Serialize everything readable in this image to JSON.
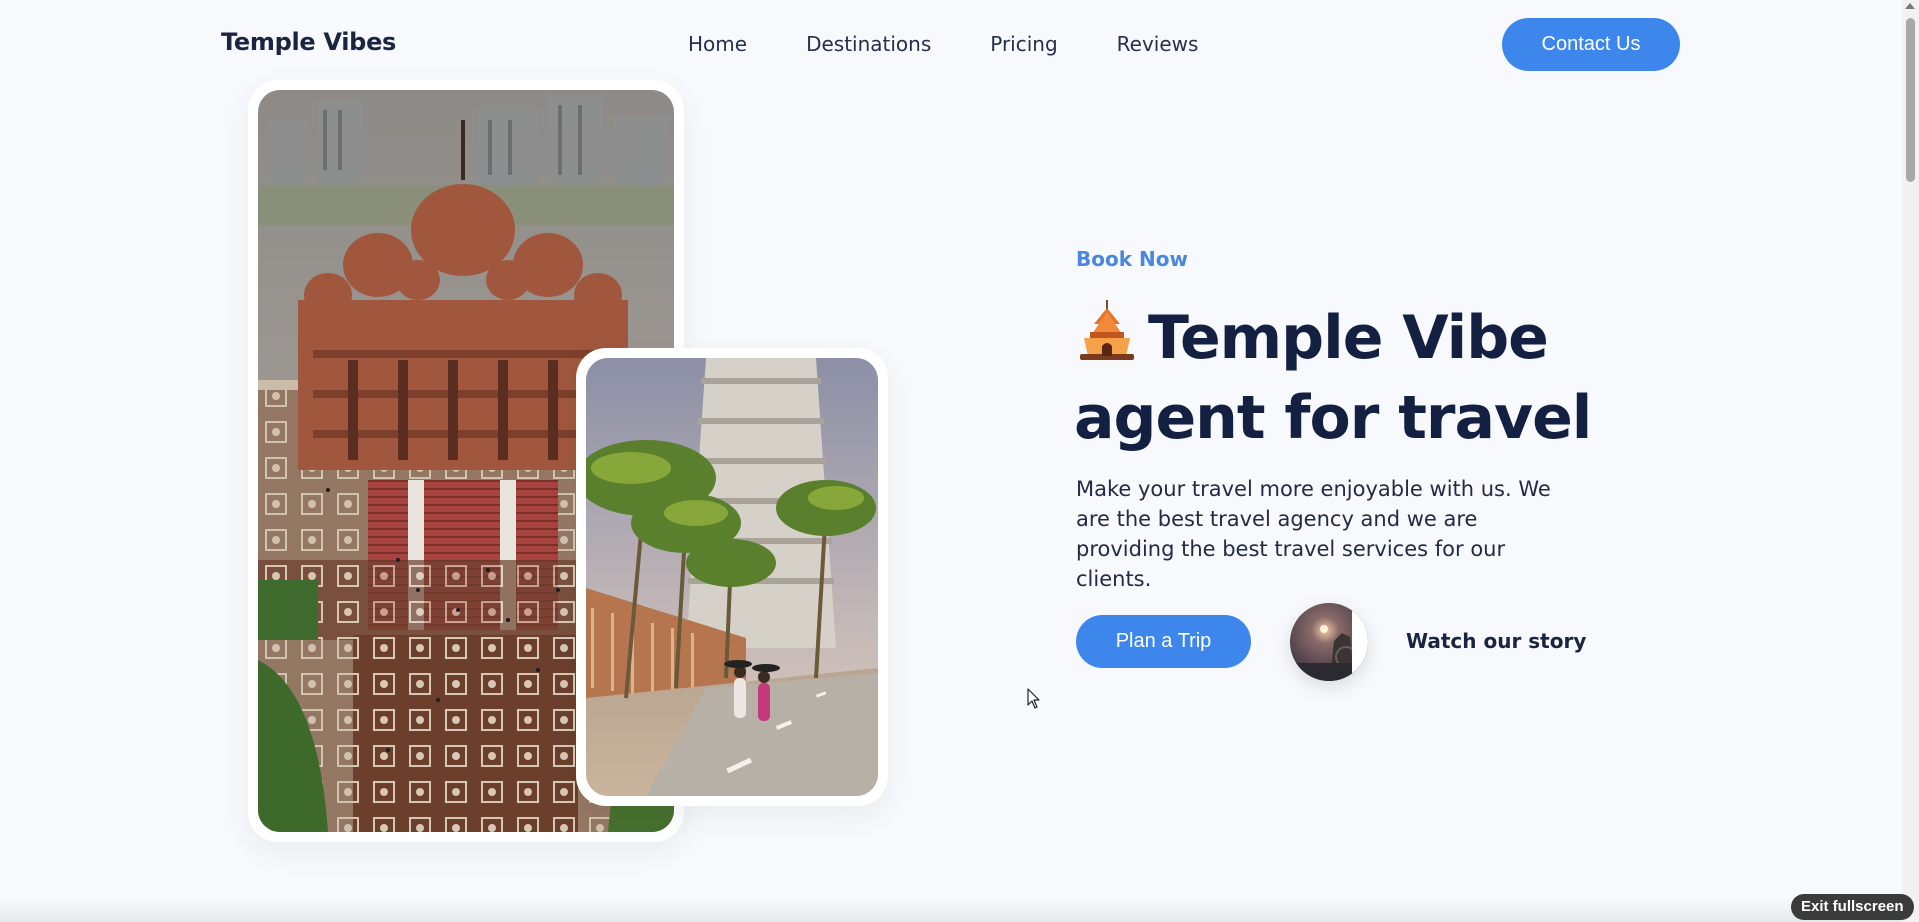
{
  "header": {
    "logo": "Temple Vibes",
    "nav": [
      "Home",
      "Destinations",
      "Pricing",
      "Reviews"
    ],
    "contact_label": "Contact Us"
  },
  "hero": {
    "eyebrow": "Book Now",
    "headline_line1": "Temple Vibe",
    "headline_line2": "agent for travel",
    "description": "Make your travel more enjoyable with us. We are the best travel agency and we are providing the best travel services for our clients.",
    "plan_label": "Plan a Trip",
    "story_label": "Watch our story"
  },
  "images": {
    "large": "temple-complex-aerial",
    "small": "temple-gopuram-palm-road"
  },
  "icons": {
    "headline": "hindu-temple-icon",
    "story": "play-story-icon"
  },
  "colors": {
    "accent": "#3d86ec",
    "heading": "#132042",
    "background": "#f7f9fc"
  },
  "overlay": {
    "exit_fullscreen": "Exit fullscreen"
  }
}
